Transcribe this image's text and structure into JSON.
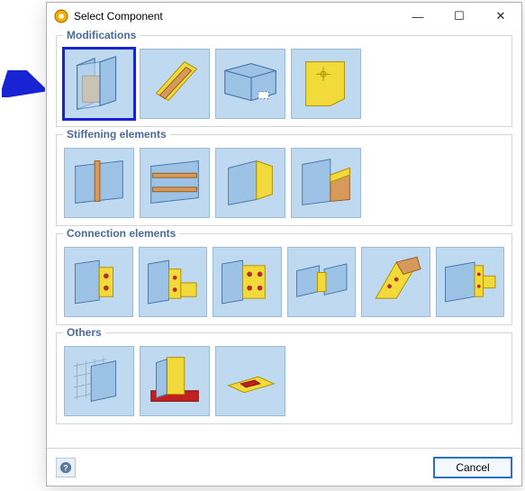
{
  "window": {
    "title": "Select Component",
    "minimize": "—",
    "maximize": "☐",
    "close": "✕"
  },
  "groups": {
    "modifications": {
      "title": "Modifications"
    },
    "stiffening": {
      "title": "Stiffening elements"
    },
    "connection": {
      "title": "Connection elements"
    },
    "others": {
      "title": "Others"
    }
  },
  "footer": {
    "cancel_label": "Cancel"
  }
}
